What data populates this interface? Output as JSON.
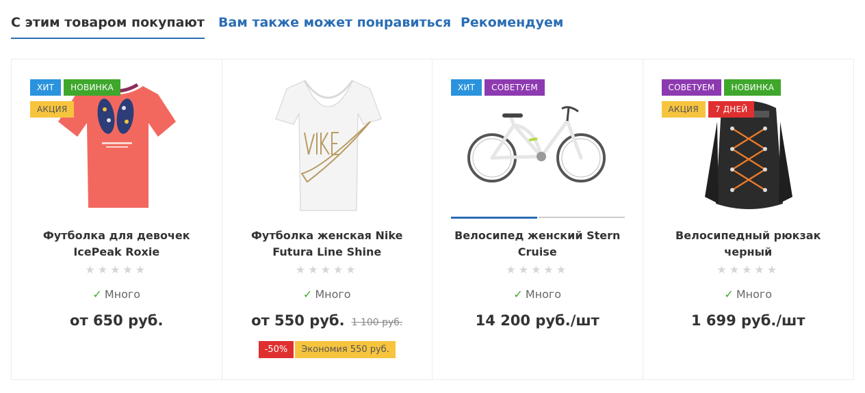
{
  "tabs": [
    {
      "label": "С этим товаром покупают",
      "active": true
    },
    {
      "label": "Вам также может понравиться",
      "active": false
    },
    {
      "label": "Рекомендуем",
      "active": false
    }
  ],
  "colors": {
    "accent": "#2a6db3",
    "sticker_hit": "#2b93dd",
    "sticker_new": "#3fa72c",
    "sticker_sale": "#f7c43e",
    "sticker_recommend": "#8d3ab0",
    "sticker_days": "#df2f2f"
  },
  "products": [
    {
      "stickers": [
        "ХИТ",
        "НОВИНКА",
        "АКЦИЯ"
      ],
      "image_icon": "coral-girls-tshirt-image",
      "name": "Футболка для девочек IcePeak Roxie",
      "rating": 0,
      "stock_label": "Много",
      "price": "от 650 руб."
    },
    {
      "stickers": [],
      "image_icon": "white-nike-tshirt-image",
      "name": "Футболка женская Nike Futura Line Shine",
      "rating": 0,
      "stock_label": "Много",
      "price": "от 550 руб.",
      "old_price": "1 100 руб.",
      "discount_percent": "-50%",
      "savings": "Экономия 550 руб."
    },
    {
      "stickers": [
        "ХИТ",
        "СОВЕТУЕМ"
      ],
      "image_icon": "bicycle-image",
      "name": "Велосипед женский Stern Cruise",
      "rating": 0,
      "stock_label": "Много",
      "price": "14 200 руб./шт"
    },
    {
      "stickers": [
        "СОВЕТУЕМ",
        "НОВИНКА",
        "АКЦИЯ",
        "7 ДНЕЙ"
      ],
      "image_icon": "black-backpack-image",
      "name": "Велосипедный рюкзак черный",
      "rating": 0,
      "stock_label": "Много",
      "price": "1 699 руб./шт"
    }
  ]
}
